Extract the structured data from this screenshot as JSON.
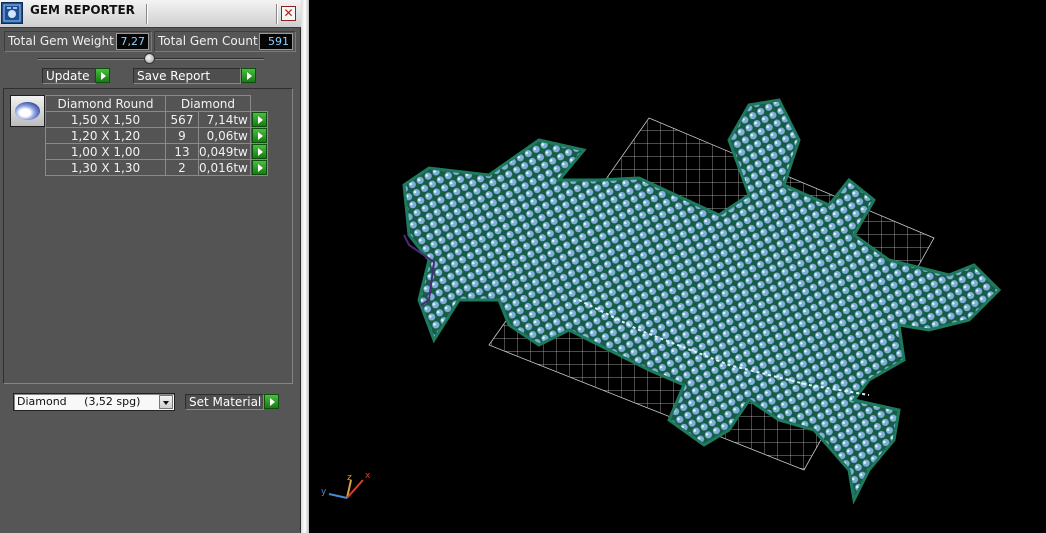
{
  "window": {
    "title": "GEM REPORTER",
    "close_symbol": "✕"
  },
  "summary": {
    "weight_label": "Total Gem Weight",
    "weight_value": "7,27",
    "count_label": "Total Gem Count",
    "count_value": "591"
  },
  "actions": {
    "update_label": "Update",
    "save_label": "Save Report"
  },
  "gem_table": {
    "header_shape": "Diamond Round",
    "header_material": "Diamond",
    "rows": [
      {
        "size": "1,50 X 1,50",
        "count": "567",
        "weight": "7,14tw"
      },
      {
        "size": "1,20 X 1,20",
        "count": "9",
        "weight": "0,06tw"
      },
      {
        "size": "1,00 X 1,00",
        "count": "13",
        "weight": "0,049tw"
      },
      {
        "size": "1,30 X 1,30",
        "count": "2",
        "weight": "0,016tw"
      }
    ]
  },
  "material": {
    "selected": "Diamond     (3,52 spg)",
    "set_label": "Set Material"
  },
  "viewport": {
    "axis_labels": {
      "x": "x",
      "y": "y",
      "z": "z"
    },
    "axis_colors": {
      "x": "#d84030",
      "y": "#4a88d8",
      "z": "#e0a040"
    },
    "model_color": "#1e7a5e",
    "stone_color": "#7fb0d8",
    "grid_color": "#c8c8c8"
  },
  "colors": {
    "accent_go": "#2e9e28",
    "panel_bg": "#565656",
    "value_text": "#8fd0ff"
  }
}
